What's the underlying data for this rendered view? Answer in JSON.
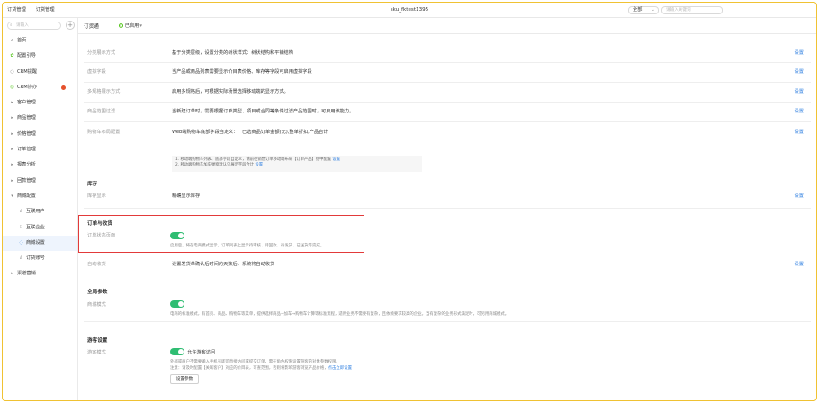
{
  "topbar": {
    "tabs": [
      "订货管理",
      "订货管理"
    ],
    "title": "sku_fktest1395",
    "scope_label": "全部",
    "search_placeholder": "请输入关键词"
  },
  "sidebar": {
    "search_placeholder": "请输入",
    "add_symbol": "+",
    "items": [
      {
        "label": "首页",
        "icon": "home-icon",
        "glyph": "⌂"
      },
      {
        "label": "配置引导",
        "icon": "guide-icon",
        "glyph": "✿"
      },
      {
        "label": "CRM提醒",
        "icon": "bell-icon",
        "glyph": "○"
      },
      {
        "label": "CRM协办",
        "icon": "assist-icon",
        "glyph": "◎"
      },
      {
        "label": "客户管理",
        "icon": "expand-icon",
        "glyph": "▸"
      },
      {
        "label": "商品管理",
        "icon": "expand-icon",
        "glyph": "▸"
      },
      {
        "label": "价格管理",
        "icon": "expand-icon",
        "glyph": "▸"
      },
      {
        "label": "订单管理",
        "icon": "expand-icon",
        "glyph": "▸"
      },
      {
        "label": "报表分析",
        "icon": "expand-icon",
        "glyph": "▸"
      },
      {
        "label": "回款管理",
        "icon": "expand-icon",
        "glyph": "▸"
      },
      {
        "label": "商城配置",
        "icon": "collapse-icon",
        "glyph": "▾"
      },
      {
        "label": "互联用户",
        "icon": "user-icon",
        "glyph": "♙"
      },
      {
        "label": "互联企业",
        "icon": "flag-icon",
        "glyph": "⚐"
      },
      {
        "label": "商城设置",
        "icon": "settings-icon",
        "glyph": "◌"
      },
      {
        "label": "订货账号",
        "icon": "account-icon",
        "glyph": "♙"
      },
      {
        "label": "渠道营销",
        "icon": "expand-icon",
        "glyph": "▸"
      }
    ]
  },
  "main": {
    "header_title": "订货通",
    "status": "已启用",
    "status_chev": "▾",
    "settings_link": "设置",
    "rows": [
      {
        "label": "分类展示方式",
        "value": "基于分类层级，设置分类的树状样式：树状结构和平铺结构"
      },
      {
        "label": "虚拟字段",
        "value": "当产品或商品列表需要显示价目表价格、库存等字段可启用虚拟字段"
      },
      {
        "label": "多规格展示方式",
        "value": "启用多规格后，可根据实际场景选择移动端的显示方式。"
      },
      {
        "label": "商品范围过滤",
        "value": "当新建订单时，需要根据订单类型、项目或合同等条件过滤产品范围时，可启用该能力。"
      },
      {
        "label": "购物车布局配置",
        "value": "Web端购物车底部字段自定义：",
        "value2": "已选商品订单金额(元),整单折扣,产品合计"
      }
    ],
    "note_lines": [
      "1. 移动端购物车列表、底部字段自定义，请前往销售订单移动端布局【订单产品】组中配置",
      "2. 移动端购物车加车弹窗默认只展示字段合计",
      "设置"
    ],
    "inventory": {
      "title": "库存",
      "label": "库存显示",
      "value": "精确显示库存"
    },
    "order_receipt": {
      "title": "订单与收货",
      "label": "订单状态页面",
      "desc": "启用后，将在电商模式显示，订单列表上显示待审核、待回款、待发货、已送货等完成。"
    },
    "auto_receipt": {
      "label": "自动收货",
      "value": "设置发货单确认后时间的天数后，系统将自动收货"
    },
    "global_params": {
      "title": "全局参数",
      "label": "商城模式",
      "desc": "电商的标准模式，有首页、商品、购物车等菜单，提供选择商品→加车→购物车计算等标准流程，适用业务不需要有复杂，且依赖要求较高的企业。当有复杂的业务形式满足时，可另用商城模式。"
    },
    "guest": {
      "title": "游客设置",
      "label": "游客模式",
      "toggle_label": "允许游客访问",
      "desc1": "外部或商户不需要输入手机号即可直接访问或提交订单，需在角色权限设置游客的对象参数权限。",
      "desc2": "注意：请及时配置【关联客户】对应的价目表，可查范围，否则将影响游客浏览产品价格，",
      "desc2_link": "点击立即设置",
      "button": "设置参数"
    }
  },
  "colors": {
    "accent": "#2f7fe0",
    "toggle_on": "#2fbd72",
    "highlight_border": "#e23a3a",
    "frame_border": "#f0c233",
    "badge": "#e5512c"
  }
}
